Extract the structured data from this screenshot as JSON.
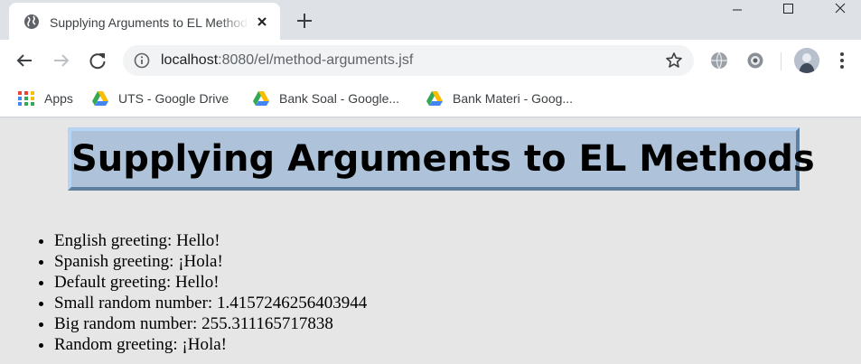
{
  "browser": {
    "tab_title": "Supplying Arguments to EL Methods",
    "url_host": "localhost",
    "url_rest": ":8080/el/method-arguments.jsf",
    "bookmarks": [
      {
        "label": "Apps",
        "icon": "apps-grid-icon"
      },
      {
        "label": "UTS - Google Drive",
        "icon": "google-drive-icon"
      },
      {
        "label": "Bank Soal - Google...",
        "icon": "google-drive-icon"
      },
      {
        "label": "Bank Materi - Goog...",
        "icon": "google-drive-icon"
      }
    ]
  },
  "page": {
    "heading": "Supplying Arguments to EL Methods",
    "items": [
      {
        "label": "English greeting: ",
        "value": "Hello!"
      },
      {
        "label": "Spanish greeting: ",
        "value": "¡Hola!"
      },
      {
        "label": "Default greeting: ",
        "value": "Hello!"
      },
      {
        "label": "Small random number: ",
        "value": "1.4157246256403944"
      },
      {
        "label": "Big random number: ",
        "value": "255.311165717838"
      },
      {
        "label": "Random greeting: ",
        "value": "¡Hola!"
      }
    ]
  },
  "colors": {
    "title_bg": "#aec3d9",
    "page_bg": "#e6e6e6",
    "chrome_bg": "#dee1e6"
  }
}
